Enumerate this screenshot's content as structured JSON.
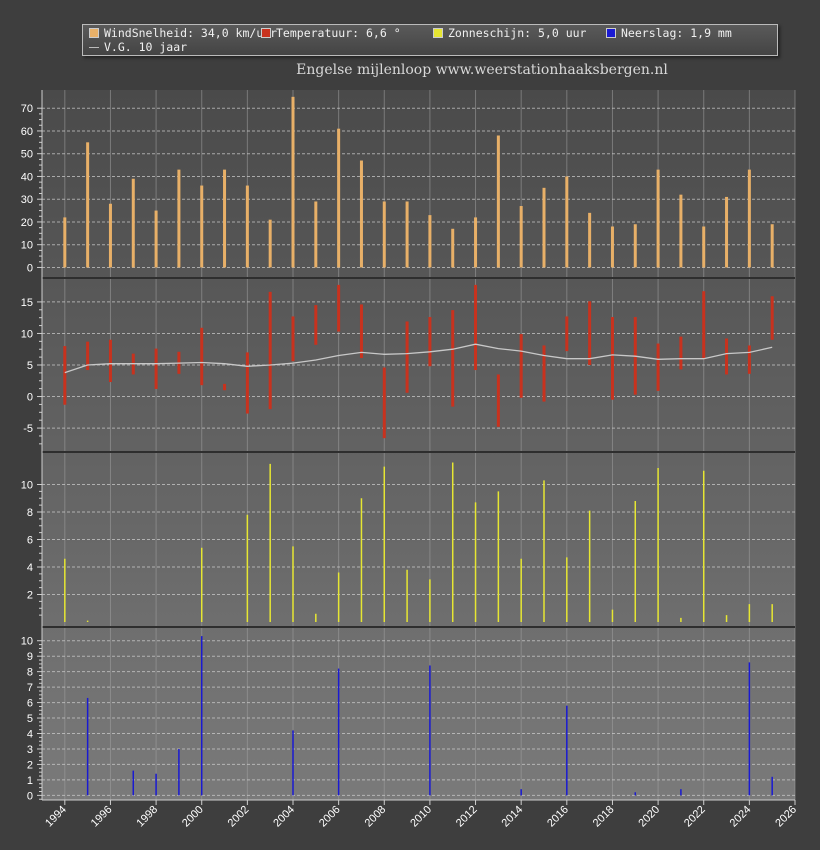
{
  "legend": {
    "wind": "WindSnelheid: 34,0 km/uur",
    "temp": "Temperatuur: 6,6 °",
    "sun": "Zonneschijn: 5,0 uur",
    "rain": "Neerslag: 1,9 mm",
    "avg": "V.G. 10 jaar"
  },
  "subtitle": "Engelse mijlenloop  www.weerstationhaaksbergen.nl",
  "colors": {
    "wind": "#e8b068",
    "temp": "#c8321e",
    "sun": "#e6e632",
    "rain": "#1a1ad2",
    "avg": "#c8c8c8"
  },
  "chart_data": {
    "type": "bar",
    "x_ticks": [
      "1994",
      "1996",
      "1998",
      "2000",
      "2002",
      "2004",
      "2006",
      "2008",
      "2010",
      "2012",
      "2014",
      "2016",
      "2018",
      "2020",
      "2022",
      "2024",
      "2026"
    ],
    "x_range": [
      1993,
      2026
    ],
    "panels": {
      "wind": {
        "ylim": [
          -2,
          78
        ],
        "yticks": [
          0,
          10,
          20,
          30,
          40,
          50,
          60,
          70
        ],
        "data": [
          [
            1994,
            22
          ],
          [
            1995,
            55
          ],
          [
            1996,
            28
          ],
          [
            1997,
            39
          ],
          [
            1998,
            25
          ],
          [
            1999,
            43
          ],
          [
            2000,
            36
          ],
          [
            2001,
            43
          ],
          [
            2002,
            36
          ],
          [
            2003,
            21
          ],
          [
            2004,
            75
          ],
          [
            2005,
            29
          ],
          [
            2006,
            61
          ],
          [
            2007,
            47
          ],
          [
            2008,
            29
          ],
          [
            2009,
            29
          ],
          [
            2010,
            23
          ],
          [
            2011,
            17
          ],
          [
            2012,
            22
          ],
          [
            2013,
            58
          ],
          [
            2014,
            27
          ],
          [
            2015,
            35
          ],
          [
            2016,
            40
          ],
          [
            2017,
            24
          ],
          [
            2018,
            18
          ],
          [
            2019,
            19
          ],
          [
            2020,
            43
          ],
          [
            2021,
            32
          ],
          [
            2022,
            18
          ],
          [
            2023,
            31
          ],
          [
            2024,
            43
          ],
          [
            2025,
            19
          ]
        ]
      },
      "temp": {
        "ylim": [
          -8,
          18
        ],
        "yticks": [
          -5,
          0,
          5,
          10,
          15
        ],
        "ranges": [
          [
            1994,
            -1.3,
            8.0
          ],
          [
            1995,
            4.2,
            8.7
          ],
          [
            1996,
            2.3,
            9.0
          ],
          [
            1997,
            3.5,
            6.8
          ],
          [
            1998,
            1.2,
            7.6
          ],
          [
            1999,
            3.6,
            7.1
          ],
          [
            2000,
            1.8,
            10.9
          ],
          [
            2001,
            1.0,
            2.0
          ],
          [
            2002,
            -2.7,
            7.0
          ],
          [
            2003,
            -2.0,
            16.6
          ],
          [
            2004,
            5.6,
            12.7
          ],
          [
            2005,
            8.2,
            14.5
          ],
          [
            2006,
            10.3,
            17.7
          ],
          [
            2007,
            6.1,
            14.6
          ],
          [
            2008,
            -6.6,
            4.6
          ],
          [
            2009,
            0.6,
            11.9
          ],
          [
            2010,
            4.8,
            12.6
          ],
          [
            2011,
            -1.6,
            13.7
          ],
          [
            2012,
            4.2,
            17.7
          ],
          [
            2013,
            -4.8,
            3.5
          ],
          [
            2014,
            -0.2,
            9.9
          ],
          [
            2015,
            -0.8,
            8.1
          ],
          [
            2016,
            7.2,
            12.7
          ],
          [
            2017,
            5.0,
            15.1
          ],
          [
            2018,
            -0.5,
            12.6
          ],
          [
            2019,
            0.3,
            12.6
          ],
          [
            2020,
            0.9,
            8.4
          ],
          [
            2021,
            4.3,
            9.5
          ],
          [
            2022,
            5.9,
            16.7
          ],
          [
            2023,
            3.5,
            9.2
          ],
          [
            2024,
            3.6,
            8.1
          ],
          [
            2025,
            9.0,
            15.9
          ]
        ],
        "avg": [
          [
            1994,
            3.8
          ],
          [
            1995,
            5.0
          ],
          [
            1996,
            5.2
          ],
          [
            1997,
            5.2
          ],
          [
            1998,
            5.2
          ],
          [
            1999,
            5.3
          ],
          [
            2000,
            5.4
          ],
          [
            2001,
            5.2
          ],
          [
            2002,
            4.8
          ],
          [
            2003,
            5.0
          ],
          [
            2004,
            5.3
          ],
          [
            2005,
            5.8
          ],
          [
            2006,
            6.5
          ],
          [
            2007,
            7.0
          ],
          [
            2008,
            6.7
          ],
          [
            2009,
            6.8
          ],
          [
            2010,
            7.1
          ],
          [
            2011,
            7.5
          ],
          [
            2012,
            8.3
          ],
          [
            2013,
            7.6
          ],
          [
            2014,
            7.2
          ],
          [
            2015,
            6.5
          ],
          [
            2016,
            6.0
          ],
          [
            2017,
            6.0
          ],
          [
            2018,
            6.6
          ],
          [
            2019,
            6.4
          ],
          [
            2020,
            5.9
          ],
          [
            2021,
            6.0
          ],
          [
            2022,
            6.0
          ],
          [
            2023,
            6.8
          ],
          [
            2024,
            7.0
          ],
          [
            2025,
            7.8
          ]
        ]
      },
      "sun": {
        "ylim": [
          0,
          12
        ],
        "yticks": [
          2,
          4,
          6,
          8,
          10
        ],
        "data": [
          [
            1994,
            4.6
          ],
          [
            1995,
            0.1
          ],
          [
            2000,
            5.4
          ],
          [
            2002,
            7.8
          ],
          [
            2003,
            11.5
          ],
          [
            2004,
            5.5
          ],
          [
            2005,
            0.6
          ],
          [
            2006,
            3.6
          ],
          [
            2007,
            9.0
          ],
          [
            2008,
            11.3
          ],
          [
            2009,
            3.8
          ],
          [
            2010,
            3.1
          ],
          [
            2011,
            11.6
          ],
          [
            2012,
            8.7
          ],
          [
            2013,
            9.5
          ],
          [
            2014,
            4.6
          ],
          [
            2015,
            10.3
          ],
          [
            2016,
            4.7
          ],
          [
            2017,
            8.1
          ],
          [
            2018,
            0.9
          ],
          [
            2019,
            8.8
          ],
          [
            2020,
            11.2
          ],
          [
            2021,
            0.3
          ],
          [
            2022,
            11.0
          ],
          [
            2023,
            0.5
          ],
          [
            2024,
            1.3
          ],
          [
            2025,
            1.3
          ]
        ]
      },
      "rain": {
        "ylim": [
          -0.3,
          10.5
        ],
        "yticks": [
          0,
          1,
          2,
          3,
          4,
          5,
          6,
          7,
          8,
          9,
          10
        ],
        "data": [
          [
            1995,
            6.3
          ],
          [
            1997,
            1.6
          ],
          [
            1998,
            1.4
          ],
          [
            1999,
            3.0
          ],
          [
            2000,
            10.3
          ],
          [
            2004,
            4.2
          ],
          [
            2006,
            8.2
          ],
          [
            2010,
            8.4
          ],
          [
            2014,
            0.4
          ],
          [
            2016,
            5.8
          ],
          [
            2019,
            0.2
          ],
          [
            2021,
            0.4
          ],
          [
            2024,
            8.6
          ],
          [
            2025,
            1.2
          ]
        ]
      }
    }
  }
}
